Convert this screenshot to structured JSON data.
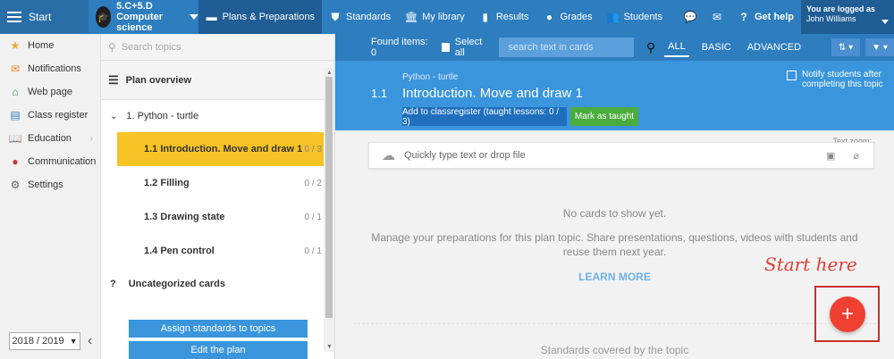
{
  "topbar": {
    "start": "Start",
    "class_line1": "5.C+5.D",
    "class_line2": "Computer science",
    "nav": [
      "Plans & Preparations",
      "Standards",
      "My library",
      "Results",
      "Grades",
      "Students"
    ],
    "help": "Get help",
    "user_line1": "You are logged as",
    "user_line2": "John Williams"
  },
  "sidebar": {
    "items": [
      "Home",
      "Notifications",
      "Web page",
      "Class register",
      "Education",
      "Communication",
      "Settings"
    ],
    "year": "2018 / 2019"
  },
  "topics": {
    "search_placeholder": "Search topics",
    "plan_overview": "Plan overview",
    "topic": "1. Python - turtle",
    "subtopics": [
      {
        "label": "1.1  Introduction. Move and draw 1",
        "count": "0 / 3"
      },
      {
        "label": "1.2  Filling",
        "count": "0 / 2"
      },
      {
        "label": "1.3  Drawing state",
        "count": "0 / 1"
      },
      {
        "label": "1.4  Pen control",
        "count": "0 / 1"
      }
    ],
    "uncategorized": "Uncategorized cards",
    "assign_btn": "Assign standards to topics",
    "edit_btn": "Edit the plan"
  },
  "main": {
    "found": "Found items: 0",
    "select_all": "Select all",
    "search_placeholder": "search text in cards",
    "filters": [
      "ALL",
      "BASIC",
      "ADVANCED"
    ],
    "topic_small": "Python - turtle",
    "topic_num": "1.1",
    "topic_title": "Introduction. Move and draw 1",
    "notify": "Notify students after completing this topic",
    "add_btn": "Add to classregister (taught lessons: 0 / 3)",
    "mark_btn": "Mark as taught",
    "text_zoom": "Text zoom:",
    "quick_placeholder": "Quickly type text or drop file",
    "empty_title": "No cards to show yet.",
    "empty_text": "Manage your preparations for this plan topic. Share presentations, questions, videos with students and reuse them next year.",
    "learn_more": "LEARN MORE",
    "standards": "Standards covered by the topic",
    "start_here": "Start here",
    "fab": "+"
  },
  "colors": {
    "topbar": "#2d7dbf",
    "active_topic": "#f7c223",
    "fab": "#ef4031",
    "mark_taught": "#4aac3c"
  }
}
